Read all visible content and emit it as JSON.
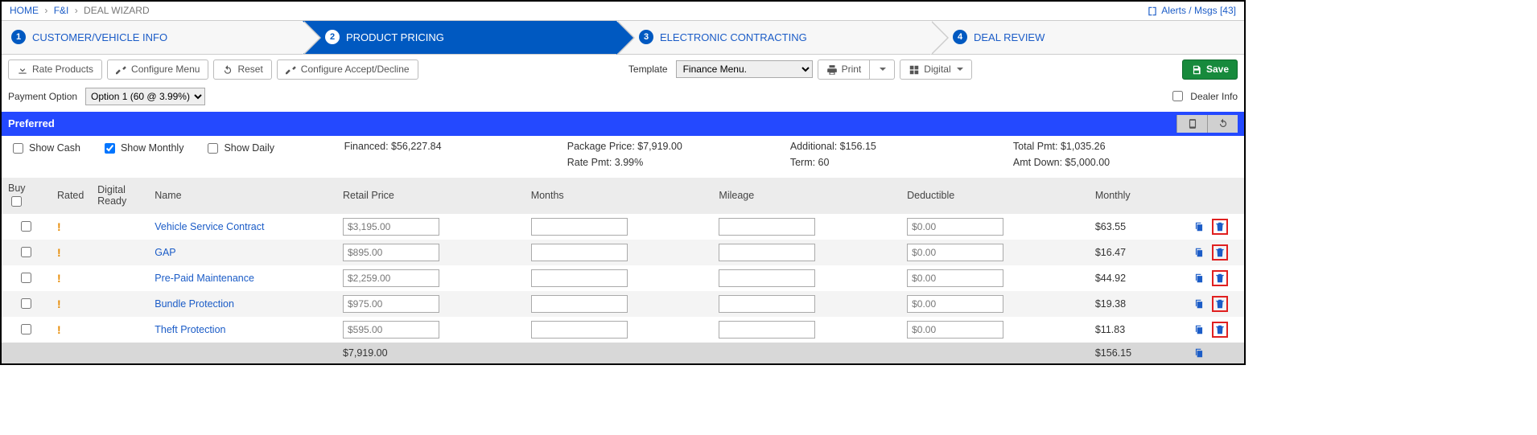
{
  "breadcrumb": {
    "home": "HOME",
    "fi": "F&I",
    "current": "DEAL WIZARD"
  },
  "alerts": {
    "text": "Alerts / Msgs [43]"
  },
  "wizard": {
    "step1": "CUSTOMER/VEHICLE INFO",
    "step2": "PRODUCT PRICING",
    "step3": "ELECTRONIC CONTRACTING",
    "step4": "DEAL REVIEW"
  },
  "toolbar": {
    "rate": "Rate Products",
    "configure_menu": "Configure Menu",
    "reset": "Reset",
    "configure_accept": "Configure Accept/Decline",
    "template_label": "Template",
    "template_value": "Finance Menu.",
    "print": "Print",
    "digital": "Digital",
    "save": "Save"
  },
  "payment": {
    "label": "Payment Option",
    "value": "Option 1 (60 @ 3.99%)",
    "dealer_info": "Dealer Info"
  },
  "preferred": {
    "title": "Preferred"
  },
  "summary": {
    "show_cash": "Show Cash",
    "show_monthly": "Show Monthly",
    "show_daily": "Show Daily",
    "financed": "Financed: $56,227.84",
    "package_price": "Package Price: $7,919.00",
    "rate_pmt": "Rate Pmt: 3.99%",
    "additional": "Additional: $156.15",
    "term": "Term: 60",
    "total_pmt": "Total Pmt: $1,035.26",
    "amt_down": "Amt Down: $5,000.00"
  },
  "columns": {
    "buy": "Buy",
    "rated": "Rated",
    "digital_ready": "Digital Ready",
    "name": "Name",
    "retail_price": "Retail Price",
    "months": "Months",
    "mileage": "Mileage",
    "deductible": "Deductible",
    "monthly": "Monthly"
  },
  "rows": [
    {
      "name": "Vehicle Service Contract",
      "price": "$3,195.00",
      "months": "",
      "mileage": "",
      "deductible": "$0.00",
      "monthly": "$63.55"
    },
    {
      "name": "GAP",
      "price": "$895.00",
      "months": "",
      "mileage": "",
      "deductible": "$0.00",
      "monthly": "$16.47"
    },
    {
      "name": "Pre-Paid Maintenance",
      "price": "$2,259.00",
      "months": "",
      "mileage": "",
      "deductible": "$0.00",
      "monthly": "$44.92"
    },
    {
      "name": "Bundle Protection",
      "price": "$975.00",
      "months": "",
      "mileage": "",
      "deductible": "$0.00",
      "monthly": "$19.38"
    },
    {
      "name": "Theft Protection",
      "price": "$595.00",
      "months": "",
      "mileage": "",
      "deductible": "$0.00",
      "monthly": "$11.83"
    }
  ],
  "totals": {
    "price": "$7,919.00",
    "monthly": "$156.15"
  }
}
